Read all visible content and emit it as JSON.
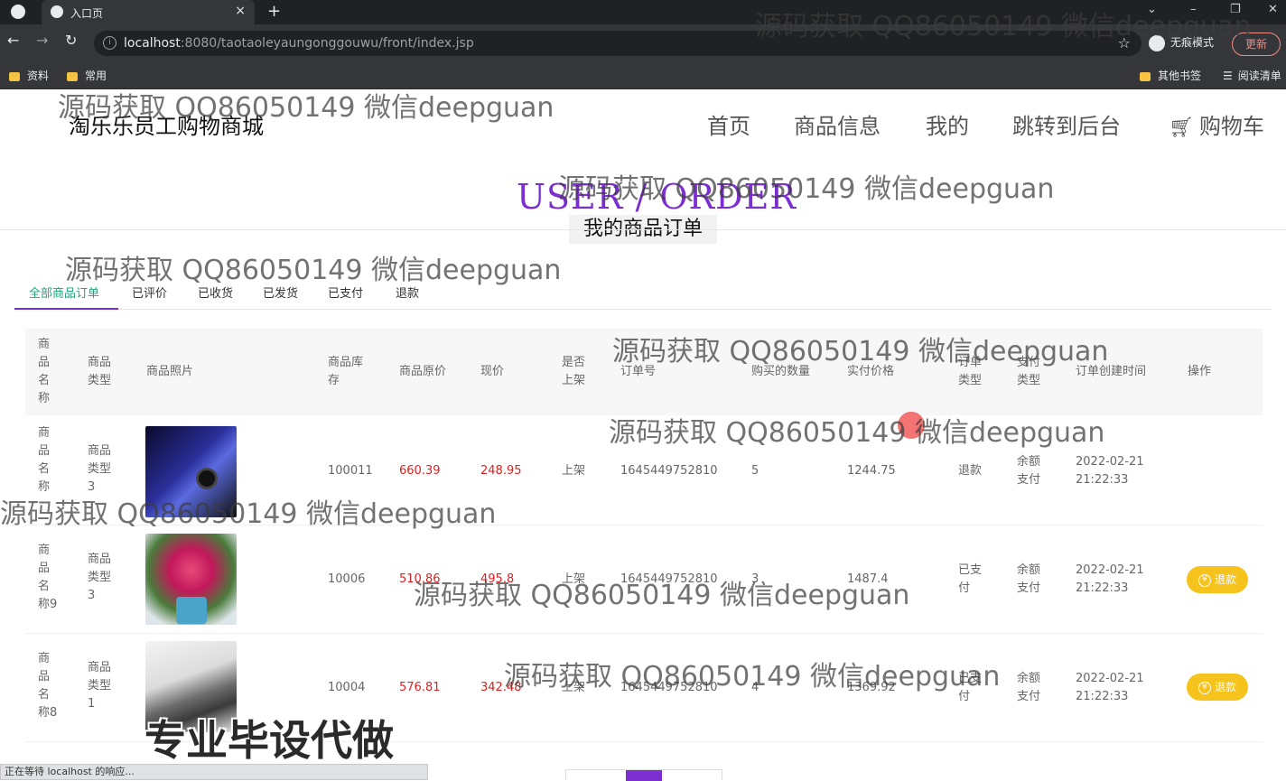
{
  "browser": {
    "tab_title": "入口页",
    "tab_close": "×",
    "new_tab": "+",
    "url_host": "localhost",
    "url_rest": ":8080/taotaoleyaungonggouwu/front/index.jsp",
    "incognito_label": "无痕模式",
    "update_label": "更新",
    "bookmarks": [
      "资料",
      "常用"
    ],
    "bookmarks_right": [
      "其他书签",
      "阅读清单"
    ],
    "status_text": "正在等待 localhost 的响应..."
  },
  "site": {
    "title": "淘乐乐员工购物商城",
    "nav": [
      "首页",
      "商品信息",
      "我的",
      "跳转到后台",
      "购物车"
    ]
  },
  "hero": {
    "en": "USER / ORDER",
    "cn": "我的商品订单"
  },
  "order_tabs": [
    "全部商品订单",
    "已评价",
    "已收货",
    "已发货",
    "已支付",
    "退款"
  ],
  "table": {
    "headers": [
      "商品名称",
      "商品类型",
      "商品照片",
      "商品库存",
      "商品原价",
      "现价",
      "是否上架",
      "订单号",
      "购买的数量",
      "实付价格",
      "订单类型",
      "支付类型",
      "订单创建时间",
      "操作"
    ],
    "rows": [
      {
        "name": "商品名称",
        "type": "商品类型3",
        "stock": "100011",
        "orig_price": "660.39",
        "price": "248.95",
        "on_sale": "上架",
        "order_no": "1645449752810",
        "qty": "5",
        "paid": "1244.75",
        "order_type": "退款",
        "pay_type": "余额支付",
        "date": "2022-02-21",
        "time": "21:22:33",
        "action": ""
      },
      {
        "name": "商品名称9",
        "type": "商品类型3",
        "stock": "10006",
        "orig_price": "510.86",
        "price": "495.8",
        "on_sale": "上架",
        "order_no": "1645449752810",
        "qty": "3",
        "paid": "1487.4",
        "order_type": "已支付",
        "pay_type": "余额支付",
        "date": "2022-02-21",
        "time": "21:22:33",
        "action": "退款"
      },
      {
        "name": "商品名称8",
        "type": "商品类型1",
        "stock": "10004",
        "orig_price": "576.81",
        "price": "342.48",
        "on_sale": "上架",
        "order_no": "1645449752810",
        "qty": "4",
        "paid": "1369.92",
        "order_type": "已支付",
        "pay_type": "余额支付",
        "date": "2022-02-21",
        "time": "21:22:33",
        "action": "退款"
      }
    ]
  },
  "watermark": "源码获取 QQ86050149 微信deepguan",
  "promo": "专业毕设代做",
  "icons": [
    "browser-logo-icon",
    "back-icon",
    "forward-icon",
    "reload-icon",
    "info-icon",
    "star-icon",
    "incognito-icon",
    "folder-icon",
    "cart-icon",
    "yen-icon"
  ],
  "colors": {
    "accent": "#7b2fd0",
    "active_tab": "#23a27b",
    "price_red": "#e02020",
    "refund_button": "#f6c21c"
  }
}
